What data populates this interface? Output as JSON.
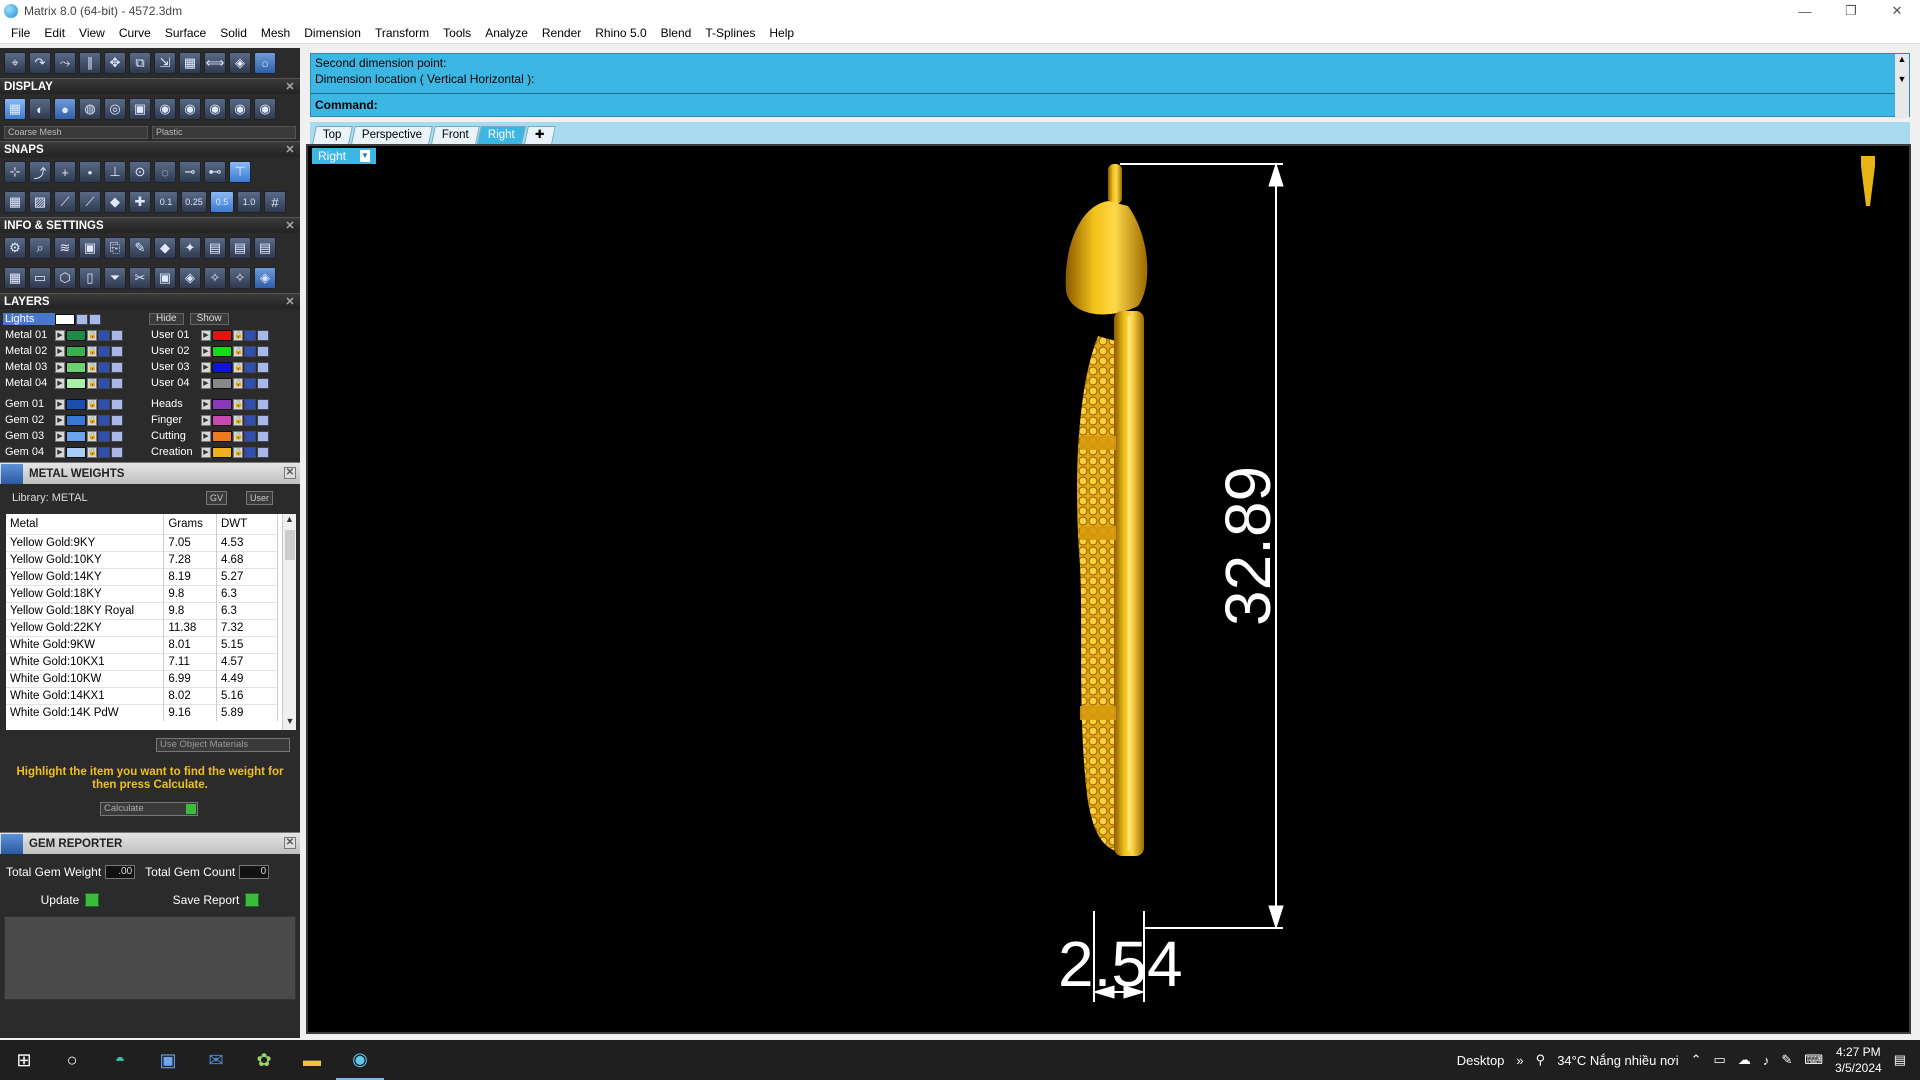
{
  "window": {
    "title": "Matrix 8.0 (64-bit) - 4572.3dm",
    "controls": [
      "—",
      "❐",
      "✕"
    ]
  },
  "menu": [
    "File",
    "Edit",
    "View",
    "Curve",
    "Surface",
    "Solid",
    "Mesh",
    "Dimension",
    "Transform",
    "Tools",
    "Analyze",
    "Render",
    "Rhino 5.0",
    "Blend",
    "T-Splines",
    "Help"
  ],
  "panels": {
    "display": {
      "title": "DISPLAY",
      "mesh_select": "Coarse Mesh",
      "material_select": "Plastic"
    },
    "snaps": {
      "title": "SNAPS",
      "values": [
        "0.1",
        "0.25",
        "0.5",
        "1.0"
      ]
    },
    "info": {
      "title": "INFO & SETTINGS"
    },
    "layers": {
      "title": "LAYERS",
      "lights": "Lights",
      "hide": "Hide",
      "show": "Show",
      "left": [
        {
          "name": "Metal 01",
          "color": "#1d8a4a"
        },
        {
          "name": "Metal 02",
          "color": "#3cb050"
        },
        {
          "name": "Metal 03",
          "color": "#6ad070"
        },
        {
          "name": "Metal 04",
          "color": "#a8f0a8"
        },
        {
          "name": "Gem 01",
          "color": "#1a4fb0"
        },
        {
          "name": "Gem 02",
          "color": "#3a78d8"
        },
        {
          "name": "Gem 03",
          "color": "#6aa4f0"
        },
        {
          "name": "Gem 04",
          "color": "#a8cdf8"
        }
      ],
      "right": [
        {
          "name": "User 01",
          "color": "#e81010"
        },
        {
          "name": "User 02",
          "color": "#10e010"
        },
        {
          "name": "User 03",
          "color": "#1010e8"
        },
        {
          "name": "User 04",
          "color": "#888888"
        },
        {
          "name": "Heads",
          "color": "#8a3ab8"
        },
        {
          "name": "Finger",
          "color": "#c84ab0"
        },
        {
          "name": "Cutting",
          "color": "#f07820"
        },
        {
          "name": "Creation",
          "color": "#f0b020"
        }
      ]
    },
    "metal_weights": {
      "title": "METAL WEIGHTS",
      "library": "Library: METAL",
      "toggle_gv": "GV",
      "toggle_user": "User",
      "columns": [
        "Metal",
        "Grams",
        "DWT"
      ],
      "rows": [
        [
          "Yellow Gold:9KY",
          "7.05",
          "4.53"
        ],
        [
          "Yellow Gold:10KY",
          "7.28",
          "4.68"
        ],
        [
          "Yellow Gold:14KY",
          "8.19",
          "5.27"
        ],
        [
          "Yellow Gold:18KY",
          "9.8",
          "6.3"
        ],
        [
          "Yellow Gold:18KY Royal",
          "9.8",
          "6.3"
        ],
        [
          "Yellow Gold:22KY",
          "11.38",
          "7.32"
        ],
        [
          "White Gold:9KW",
          "8.01",
          "5.15"
        ],
        [
          "White Gold:10KX1",
          "7.11",
          "4.57"
        ],
        [
          "White Gold:10KW",
          "6.99",
          "4.49"
        ],
        [
          "White Gold:14KX1",
          "8.02",
          "5.16"
        ],
        [
          "White Gold:14K PdW",
          "9.16",
          "5.89"
        ]
      ],
      "use_object_materials": "Use Object Materials",
      "hint": "Highlight the item you want to find the weight for then press Calculate.",
      "calculate": "Calculate"
    },
    "gem_reporter": {
      "title": "GEM REPORTER",
      "weight_label": "Total Gem Weight",
      "weight_value": ".00",
      "count_label": "Total Gem Count",
      "count_value": "0",
      "update": "Update",
      "save": "Save Report"
    }
  },
  "command": {
    "history": [
      "Second dimension point:",
      "Dimension location ( Vertical  Horizontal ):"
    ],
    "prompt": "Command:"
  },
  "viewport_tabs": [
    "Top",
    "Perspective",
    "Front",
    "Right"
  ],
  "active_tab": "Right",
  "viewport": {
    "label": "Right",
    "dim_vertical": "32.89",
    "dim_horizontal": "2.54",
    "colors": {
      "gold": "#e8b417",
      "dim": "#ffffff"
    }
  },
  "taskbar": {
    "desktop": "Desktop",
    "weather": "34°C  Nắng nhiều nơi",
    "time": "4:27 PM",
    "date": "3/5/2024"
  }
}
